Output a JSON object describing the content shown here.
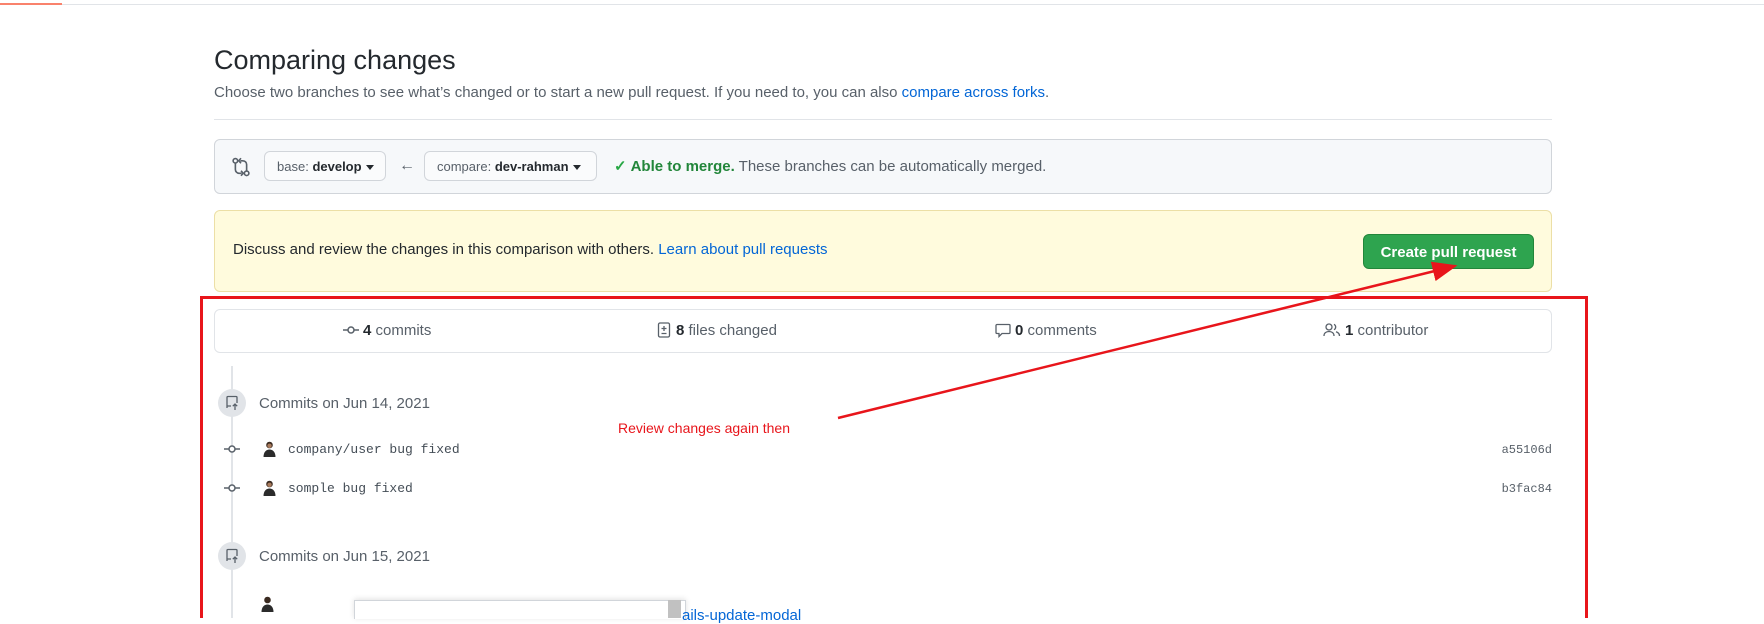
{
  "header": {
    "title": "Comparing changes",
    "subtitle": "Choose two branches to see what’s changed or to start a new pull request. If you need to, you can also",
    "subtitle_link": "compare across forks",
    "subtitle_end": "."
  },
  "range": {
    "base_prefix": "base:",
    "base_branch": "develop",
    "arrow": "←",
    "compare_prefix": "compare:",
    "compare_branch": "dev-rahman",
    "merge_check": "✓",
    "merge_ok": "Able to merge.",
    "merge_note": "These branches can be automatically merged."
  },
  "flash": {
    "message": "Discuss and review the changes in this comparison with others.",
    "link": "Learn about pull requests",
    "button": "Create pull request"
  },
  "stats": {
    "commits_count": "4",
    "commits_label": "commits",
    "files_count": "8",
    "files_label": "files changed",
    "comments_count": "0",
    "comments_label": "comments",
    "contributors_count": "1",
    "contributors_label": "contributor"
  },
  "commit_groups": [
    {
      "title": "Commits on Jun 14, 2021",
      "commits": [
        {
          "message": "company/user bug fixed",
          "sha": "a55106d"
        },
        {
          "message": "somple bug fixed",
          "sha": "b3fac84"
        }
      ]
    },
    {
      "title": "Commits on Jun 15, 2021"
    }
  ],
  "annotation": {
    "text": "Review changes again then",
    "color": "#e8151b"
  },
  "cutoff": {
    "link_fragment": "ails-update-modal"
  },
  "colors": {
    "primary_button": "#2ea44f",
    "link": "#0366d6",
    "success": "#22863a",
    "flash_bg": "#fffbdd"
  },
  "icons": {
    "range_icon": "git-compare-icon",
    "commit_icon": "git-commit-icon",
    "file_icon": "file-diff-icon",
    "comment_icon": "comment-icon",
    "people_icon": "people-icon",
    "repo_push_icon": "repo-push-icon"
  }
}
